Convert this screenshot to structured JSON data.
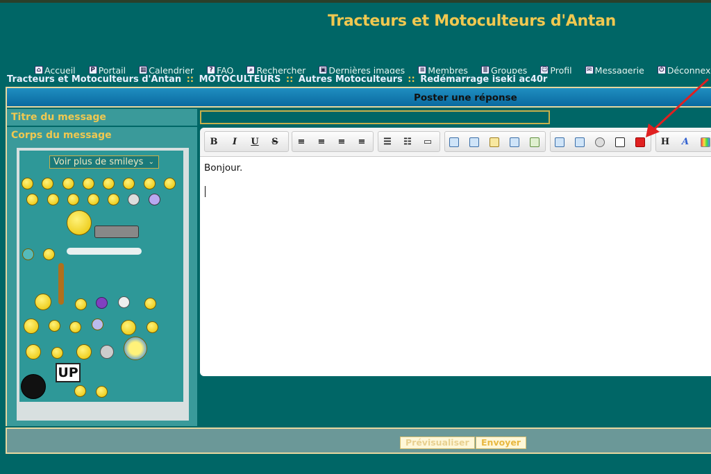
{
  "site": {
    "title": "Tracteurs et Motoculteurs d'Antan"
  },
  "nav": [
    {
      "label": "Accueil",
      "icon": "home-icon"
    },
    {
      "label": "Portail",
      "icon": "portal-icon"
    },
    {
      "label": "Calendrier",
      "icon": "calendar-icon"
    },
    {
      "label": "FAQ",
      "icon": "faq-icon"
    },
    {
      "label": "Rechercher",
      "icon": "search-icon"
    },
    {
      "label": "Dernières images",
      "icon": "images-icon"
    },
    {
      "label": "Membres",
      "icon": "members-icon"
    },
    {
      "label": "Groupes",
      "icon": "groups-icon"
    },
    {
      "label": "Profil",
      "icon": "profile-icon"
    },
    {
      "label": "Messagerie",
      "icon": "mail-icon"
    },
    {
      "label": "Déconnexion",
      "icon": "logout-icon"
    }
  ],
  "breadcrumb": [
    "Tracteurs et Motoculteurs d'Antan",
    "MOTOCULTEURS",
    "Autres Motoculteurs",
    "Redémarrage iseki ac40r"
  ],
  "breadcrumb_sep": "::",
  "form": {
    "header": "Poster une réponse",
    "title_label": "Titre du message",
    "title_value": "",
    "body_label": "Corps du message",
    "smileys_select": "Voir plus de smileys",
    "body_text": "Bonjour."
  },
  "toolbar": {
    "bold": "B",
    "italic": "I",
    "underline": "U",
    "strike": "S",
    "heading": "H",
    "font": "A"
  },
  "smiley_big_sign": "UP",
  "buttons": {
    "preview": "Prévisualiser",
    "send": "Envoyer"
  },
  "colors": {
    "background": "#006666",
    "title": "#f0c850",
    "header": "#1f8ec0",
    "arrow": "#e02020"
  }
}
